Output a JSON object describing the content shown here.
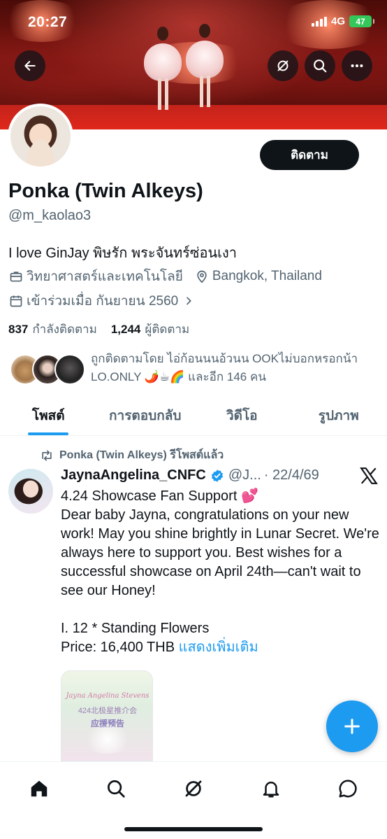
{
  "status_bar": {
    "time": "20:27",
    "network": "4G",
    "battery": "47"
  },
  "header_actions": {
    "back_icon": "arrow-left-icon",
    "grok_icon": "slash-circle-icon",
    "search_icon": "search-icon",
    "more_icon": "more-horizontal-icon"
  },
  "profile": {
    "display_name": "Ponka (Twin Alkeys)",
    "handle": "@m_kaolao3",
    "follow_label": "ติดตาม",
    "bio": "I love GinJay พิษรัก พระจันทร์ซ่อนเงา",
    "category": "วิทยาศาสตร์และเทคโนโลยี",
    "location": "Bangkok, Thailand",
    "joined": "เข้าร่วมเมื่อ กันยายน 2560",
    "following_count": "837",
    "following_label": "กำลังติดตาม",
    "followers_count": "1,244",
    "followers_label": "ผู้ติดตาม",
    "followed_by_line1": "ถูกติดตามโดย ไอ่ก้อนนนอ้วนน OOKไม่บอกหรอกน้า",
    "followed_by_line2": "LO.ONLY 🌶️☕🌈 และอีก 146 คน"
  },
  "tabs": [
    {
      "label": "โพสต์",
      "active": true
    },
    {
      "label": "การตอบกลับ",
      "active": false
    },
    {
      "label": "วิดีโอ",
      "active": false
    },
    {
      "label": "รูปภาพ",
      "active": false
    }
  ],
  "tweet": {
    "repost_label": "Ponka (Twin Alkeys) รีโพสต์แล้ว",
    "author_name": "JaynaAngelina_CNFC",
    "author_handle": "@J...",
    "date": "· 22/4/69",
    "line1": "4.24 Showcase Fan Support 💕",
    "line2": "Dear baby Jayna, congratulations on your new work! May you shine brightly in Lunar Secret. We're always here to support you. Best wishes for a successful showcase on April 24th—can't wait to see our Honey!",
    "line3": "I. 12 * Standing Flowers",
    "line4": "Price: 16,400 THB",
    "show_more": "แสดงเพิ่มเติม",
    "media_text1": "Jayna Angelina Stevens",
    "media_text2": "424北极星推介会",
    "media_text3": "应援预告"
  },
  "colors": {
    "accent": "#1d9bf0",
    "text": "#0f1419",
    "muted": "#536471",
    "banner_red": "#e0271b",
    "verified": "#1d9bf0"
  },
  "bottom_nav": [
    "home-icon",
    "search-icon",
    "grok-icon",
    "notifications-icon",
    "messages-icon"
  ]
}
